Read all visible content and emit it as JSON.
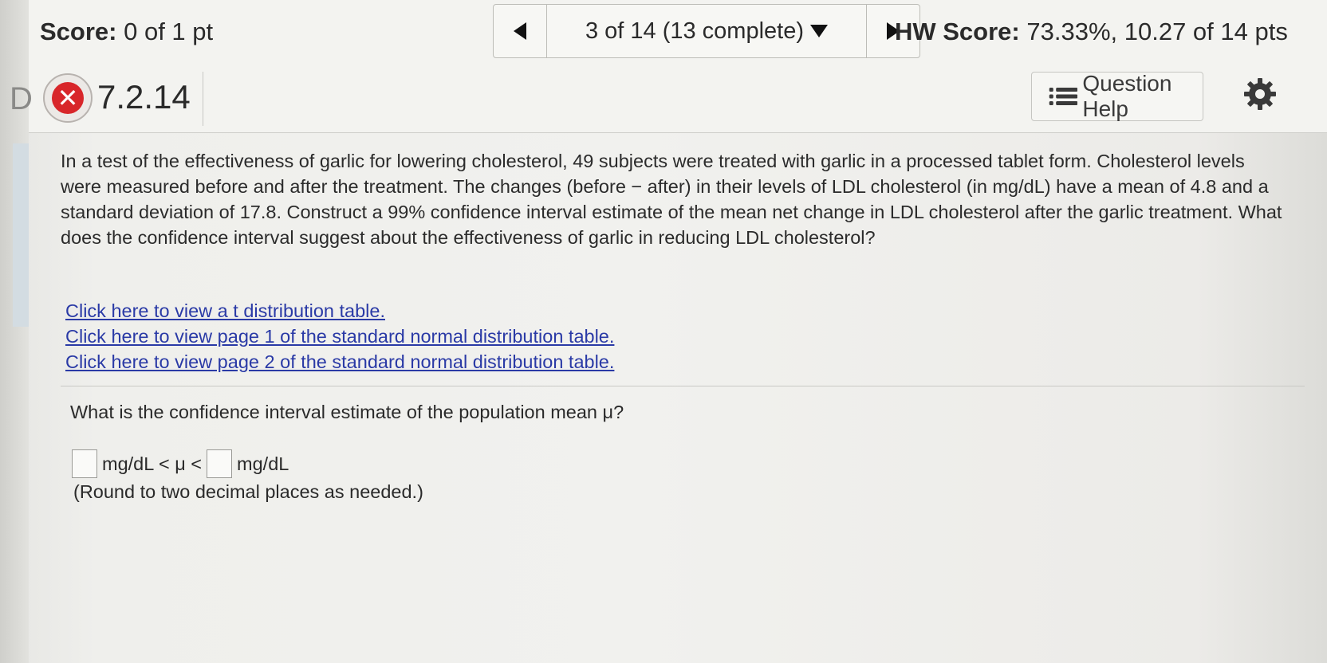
{
  "header": {
    "score_label": "Score:",
    "score_value": "0 of 1 pt",
    "nav": {
      "prev_icon": "triangle-left-icon",
      "position": "3 of 14 (13 complete)",
      "dropdown_icon": "triangle-down-icon",
      "next_icon": "triangle-right-icon"
    },
    "hw_score_label": "HW Score:",
    "hw_score_value": "73.33%, 10.27 of 14 pts"
  },
  "question_header": {
    "side_letter": "D",
    "status_icon": "incorrect-x-icon",
    "status_mark": "✕",
    "number": "7.2.14",
    "help_label": "Question Help",
    "help_icon": "list-icon",
    "settings_icon": "gear-icon"
  },
  "problem": {
    "text": "In a test of the effectiveness of garlic for lowering cholesterol, 49 subjects were treated with garlic in a processed tablet form. Cholesterol levels were measured before and after the treatment. The changes (before − after) in their levels of LDL cholesterol (in mg/dL) have a mean of 4.8 and a standard deviation of 17.8. Construct a 99% confidence interval estimate of the mean net change in LDL cholesterol after the garlic treatment. What does the confidence interval suggest about the effectiveness of garlic in reducing LDL cholesterol?",
    "links": [
      "Click here to view a t distribution table.",
      "Click here to view page 1 of the standard normal distribution table.",
      "Click here to view page 2 of the standard normal distribution table."
    ]
  },
  "part": {
    "question": "What is the confidence interval estimate of the population mean μ?",
    "lower_value": "",
    "middle_text": "mg/dL < μ <",
    "upper_value": "",
    "unit_text": "mg/dL",
    "note": "(Round to two decimal places as needed.)"
  },
  "colors": {
    "link": "#2a3aa6",
    "incorrect": "#d8262a",
    "background": "#f1f1ee"
  }
}
